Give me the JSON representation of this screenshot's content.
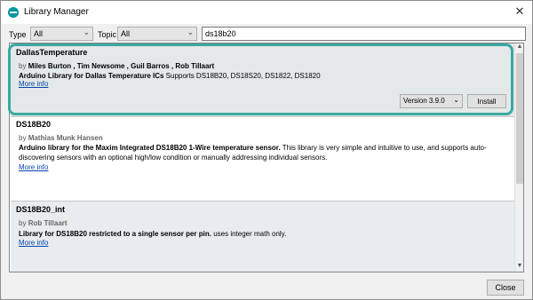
{
  "window": {
    "title": "Library Manager",
    "close_glyph": "✕"
  },
  "filters": {
    "type_label": "Type",
    "type_value": "All",
    "topic_label": "Topic",
    "topic_value": "All",
    "search_value": "ds18b20"
  },
  "libraries": [
    {
      "name": "DallasTemperature",
      "by": "by",
      "authors": "Miles Burton , Tim Newsome , Guil Barros , Rob Tillaart",
      "desc_bold": "Arduino Library for Dallas Temperature ICs",
      "desc_rest": " Supports DS18B20, DS18S20, DS1822, DS1820",
      "more": "More info",
      "version": "Version 3.9.0",
      "install": "Install"
    },
    {
      "name": "DS18B20",
      "by": "by",
      "authors": "Mathias Munk Hansen",
      "desc_bold": "Arduino library for the Maxim Integrated DS18B20 1-Wire temperature sensor.",
      "desc_rest": " This library is very simple and intuitive to use, and supports auto-discovering sensors with an optional high/low condition or manually addressing individual sensors.",
      "more": "More info"
    },
    {
      "name": "DS18B20_int",
      "by": "by",
      "authors": "Rob Tillaart",
      "desc_bold": "Library for DS18B20 restricted to a single sensor per pin.",
      "desc_rest": " uses integer math only.",
      "more": "More info"
    }
  ],
  "footer": {
    "close_label": "Close"
  },
  "colors": {
    "highlight": "#3aa9a0",
    "link": "#0645ad",
    "app_icon": "#00979c"
  }
}
